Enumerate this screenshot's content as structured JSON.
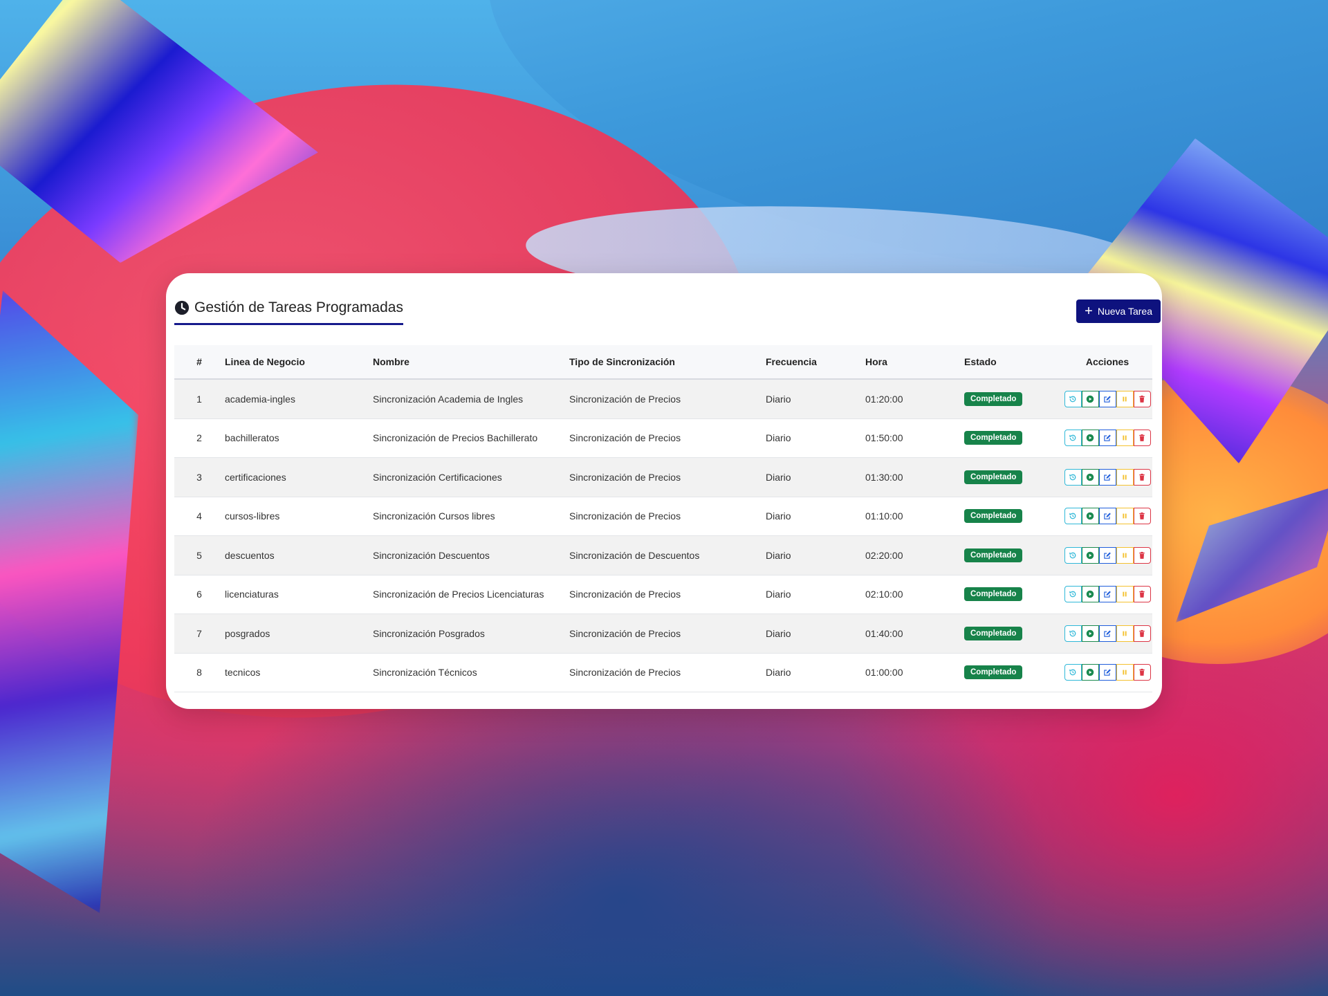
{
  "header": {
    "title": "Gestión de Tareas Programadas",
    "new_button": "Nueva Tarea"
  },
  "table": {
    "columns": [
      "#",
      "Linea de Negocio",
      "Nombre",
      "Tipo de Sincronización",
      "Frecuencia",
      "Hora",
      "Estado",
      "Acciones"
    ],
    "rows": [
      {
        "idx": "1",
        "line": "academia-ingles",
        "name": "Sincronización Academia de Ingles",
        "type": "Sincronización de Precios",
        "freq": "Diario",
        "time": "01:20:00",
        "state": "Completado"
      },
      {
        "idx": "2",
        "line": "bachilleratos",
        "name": "Sincronización de Precios Bachillerato",
        "type": "Sincronización de Precios",
        "freq": "Diario",
        "time": "01:50:00",
        "state": "Completado"
      },
      {
        "idx": "3",
        "line": "certificaciones",
        "name": "Sincronización Certificaciones",
        "type": "Sincronización de Precios",
        "freq": "Diario",
        "time": "01:30:00",
        "state": "Completado"
      },
      {
        "idx": "4",
        "line": "cursos-libres",
        "name": "Sincronización Cursos libres",
        "type": "Sincronización de Precios",
        "freq": "Diario",
        "time": "01:10:00",
        "state": "Completado"
      },
      {
        "idx": "5",
        "line": "descuentos",
        "name": "Sincronización Descuentos",
        "type": "Sincronización de Descuentos",
        "freq": "Diario",
        "time": "02:20:00",
        "state": "Completado"
      },
      {
        "idx": "6",
        "line": "licenciaturas",
        "name": "Sincronización de Precios Licenciaturas",
        "type": "Sincronización de Precios",
        "freq": "Diario",
        "time": "02:10:00",
        "state": "Completado"
      },
      {
        "idx": "7",
        "line": "posgrados",
        "name": "Sincronización Posgrados",
        "type": "Sincronización de Precios",
        "freq": "Diario",
        "time": "01:40:00",
        "state": "Completado"
      },
      {
        "idx": "8",
        "line": "tecnicos",
        "name": "Sincronización Técnicos",
        "type": "Sincronización de Precios",
        "freq": "Diario",
        "time": "01:00:00",
        "state": "Completado"
      }
    ]
  },
  "icons": {
    "title": "clock-icon",
    "new_button": "plus-icon",
    "actions": [
      "history-icon",
      "play-icon",
      "edit-icon",
      "pause-icon",
      "trash-icon"
    ]
  },
  "colors": {
    "accent": "#0e127e",
    "badge": "#17834a",
    "history": "#2fb8d8",
    "run": "#1a8a4f",
    "edit": "#1f5ddb",
    "pause": "#f4c12f",
    "delete": "#dc3545"
  }
}
